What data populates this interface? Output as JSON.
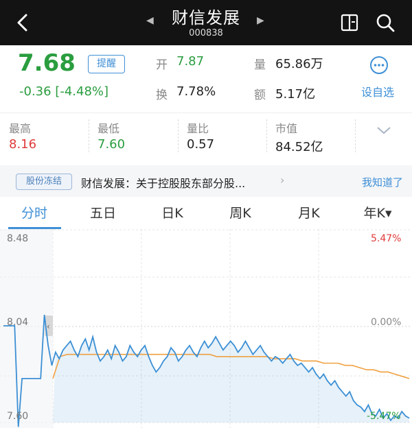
{
  "header": {
    "title": "财信发展",
    "code": "000838",
    "prev_glyph": "◀",
    "next_glyph": "▶"
  },
  "quote": {
    "price": "7.68",
    "change": "-0.36  [-4.48%]",
    "remind_label": "提醒",
    "open_label": "开",
    "open_value": "7.87",
    "turnover_label": "换",
    "turnover_value": "7.78%",
    "volume_label": "量",
    "volume_value": "65.86万",
    "amount_label": "额",
    "amount_value": "5.17亿",
    "favorite_label": "设自选"
  },
  "stats": [
    {
      "label": "最高",
      "value": "8.16"
    },
    {
      "label": "最低",
      "value": "7.60"
    },
    {
      "label": "量比",
      "value": "0.57"
    },
    {
      "label": "市值",
      "value": "84.52亿"
    }
  ],
  "notice": {
    "tag": "股份冻结",
    "text": "财信发展：关于控股股东部分股...",
    "arrow": "›",
    "dismiss": "我知道了"
  },
  "tabs": [
    "分时",
    "五日",
    "日K",
    "周K",
    "月K",
    "年K▾"
  ],
  "chart_data": {
    "type": "line",
    "y_left_ticks": [
      "8.48",
      "8.04",
      "7.60"
    ],
    "y_right_ticks": [
      "5.47%",
      "0.00%",
      "-5.47%"
    ],
    "ylim": [
      7.6,
      8.48
    ],
    "prev_close": 8.04,
    "series": [
      {
        "values": [
          8.04,
          8.04,
          8.04,
          8.04,
          7.58,
          7.8,
          7.8,
          7.8,
          7.8,
          7.8,
          7.8,
          8.09,
          7.95,
          7.86,
          7.92,
          7.89,
          7.93,
          7.95,
          7.97,
          7.93,
          7.9,
          7.95,
          7.98,
          7.93,
          7.99,
          7.92,
          7.88,
          7.9,
          7.93,
          7.89,
          7.95,
          7.92,
          7.88,
          7.9,
          7.95,
          7.92,
          7.9,
          7.93,
          7.95,
          7.9,
          7.86,
          7.83,
          7.85,
          7.88,
          7.9,
          7.94,
          7.92,
          7.88,
          7.9,
          7.93,
          7.95,
          7.92,
          7.9,
          7.94,
          7.97,
          7.94,
          7.96,
          7.99,
          7.96,
          7.93,
          7.95,
          7.97,
          7.95,
          7.92,
          7.94,
          7.97,
          7.94,
          7.91,
          7.93,
          7.95,
          7.92,
          7.9,
          7.88,
          7.9,
          7.89,
          7.87,
          7.89,
          7.91,
          7.88,
          7.86,
          7.87,
          7.85,
          7.83,
          7.85,
          7.82,
          7.8,
          7.82,
          7.79,
          7.77,
          7.79,
          7.76,
          7.74,
          7.72,
          7.74,
          7.7,
          7.68,
          7.67,
          7.65,
          7.68,
          7.64,
          7.63,
          7.66,
          7.62,
          7.64,
          7.61,
          7.63,
          7.62,
          7.65,
          7.63,
          7.62
        ]
      },
      {
        "values": [
          7.8,
          7.9,
          7.91,
          7.91,
          7.91,
          7.91,
          7.91,
          7.91,
          7.91,
          7.91,
          7.91,
          7.91,
          7.91,
          7.91,
          7.91,
          7.91,
          7.91,
          7.91,
          7.91,
          7.91,
          7.91,
          7.91,
          7.91,
          7.9,
          7.9,
          7.9,
          7.9,
          7.9,
          7.9,
          7.9,
          7.9,
          7.89,
          7.89,
          7.89,
          7.89,
          7.88,
          7.88,
          7.88,
          7.87,
          7.87,
          7.87,
          7.86,
          7.86,
          7.85,
          7.84,
          7.84,
          7.83,
          7.83,
          7.82,
          7.81,
          7.8
        ]
      }
    ]
  },
  "colors": {
    "up": "#e03a3a",
    "down": "#2a9d3f",
    "accent": "#3e8fd6",
    "price_line": "#3b8fd4",
    "avg_line": "#f0a040"
  }
}
